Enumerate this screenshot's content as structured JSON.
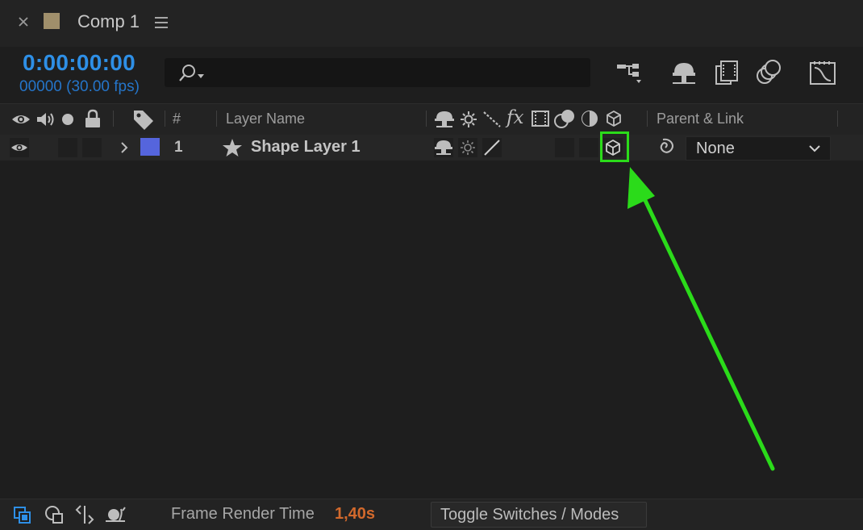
{
  "panel": {
    "title": "Comp 1",
    "swatch_color": "#a08f6b",
    "menu_icon": "hamburger-icon",
    "close_icon": "close-icon"
  },
  "time": {
    "timecode": "0:00:00:00",
    "frame_info": "00000 (30.00 fps)"
  },
  "search": {
    "value": "",
    "icon": "search-icon"
  },
  "toolbar": {
    "icons": [
      "flowchart-icon",
      "draft-3d-icon",
      "frame-blending-icon",
      "motion-blur-icon",
      "graph-editor-icon"
    ]
  },
  "columns": {
    "index": "#",
    "layer_name": "Layer Name",
    "fx": "fx",
    "parent": "Parent & Link"
  },
  "layers": [
    {
      "index": "1",
      "name": "Shape Layer 1",
      "color": "#5565dd",
      "parent": "None",
      "threed_highlighted": true
    }
  ],
  "footer": {
    "frame_render_label": "Frame Render Time",
    "frame_render_value": "1,40s",
    "toggle_label": "Toggle Switches / Modes"
  },
  "colors": {
    "accent_blue": "#2e8fe6",
    "render_orange": "#d2692c",
    "highlight_green": "#2bdb1a"
  }
}
